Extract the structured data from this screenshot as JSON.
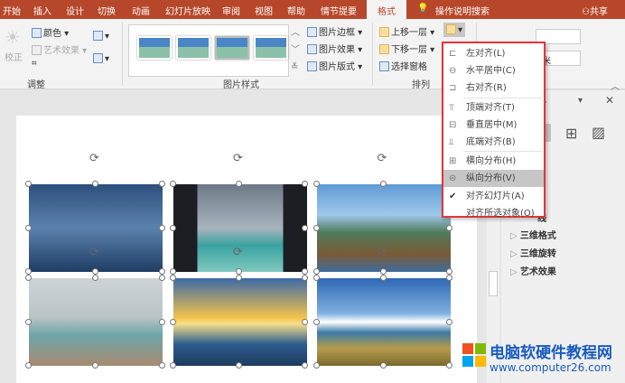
{
  "tabs": [
    "开始",
    "插入",
    "设计",
    "切换",
    "动画",
    "幻灯片放映",
    "审阅",
    "视图",
    "帮助",
    "情节提要",
    "格式",
    "操作说明搜索"
  ],
  "share": "共享",
  "ribbon": {
    "adjust": {
      "correct": "校正",
      "color": "颜色",
      "artistic": "艺术效果",
      "group": "调整"
    },
    "styles": {
      "border": "图片边框",
      "effects": "图片效果",
      "layout": "图片版式",
      "group": "图片样式"
    },
    "arrange": {
      "forward": "上移一层",
      "backward": "下移一层",
      "pane": "选择窗格",
      "group": "排列"
    },
    "size": {
      "unit": "米"
    }
  },
  "align_menu": {
    "items": [
      {
        "label": "左对齐(L)",
        "icon": "align-left-icon"
      },
      {
        "label": "水平居中(C)",
        "icon": "align-center-icon"
      },
      {
        "label": "右对齐(R)",
        "icon": "align-right-icon"
      },
      {
        "label": "顶端对齐(T)",
        "icon": "align-top-icon"
      },
      {
        "label": "垂直居中(M)",
        "icon": "align-middle-icon"
      },
      {
        "label": "底端对齐(B)",
        "icon": "align-bottom-icon"
      },
      {
        "label": "横向分布(H)",
        "icon": "distribute-horizontal-icon"
      },
      {
        "label": "纵向分布(V)",
        "icon": "distribute-vertical-icon",
        "highlighted": true
      },
      {
        "label": "对齐幻灯片(A)",
        "icon": "check-icon",
        "checked": true
      },
      {
        "label": "对齐所选对象(O)",
        "icon": ""
      }
    ]
  },
  "pane": {
    "title_partial": "...",
    "items": [
      "线",
      "三维格式",
      "三维旋转",
      "艺术效果"
    ]
  },
  "watermark": {
    "title": "电脑软硬件教程网",
    "url": "www.computer26.com"
  },
  "colors": {
    "tab_bar": "#b7472a",
    "menu_border": "#e0373a",
    "watermark": "#1a5bbf"
  }
}
